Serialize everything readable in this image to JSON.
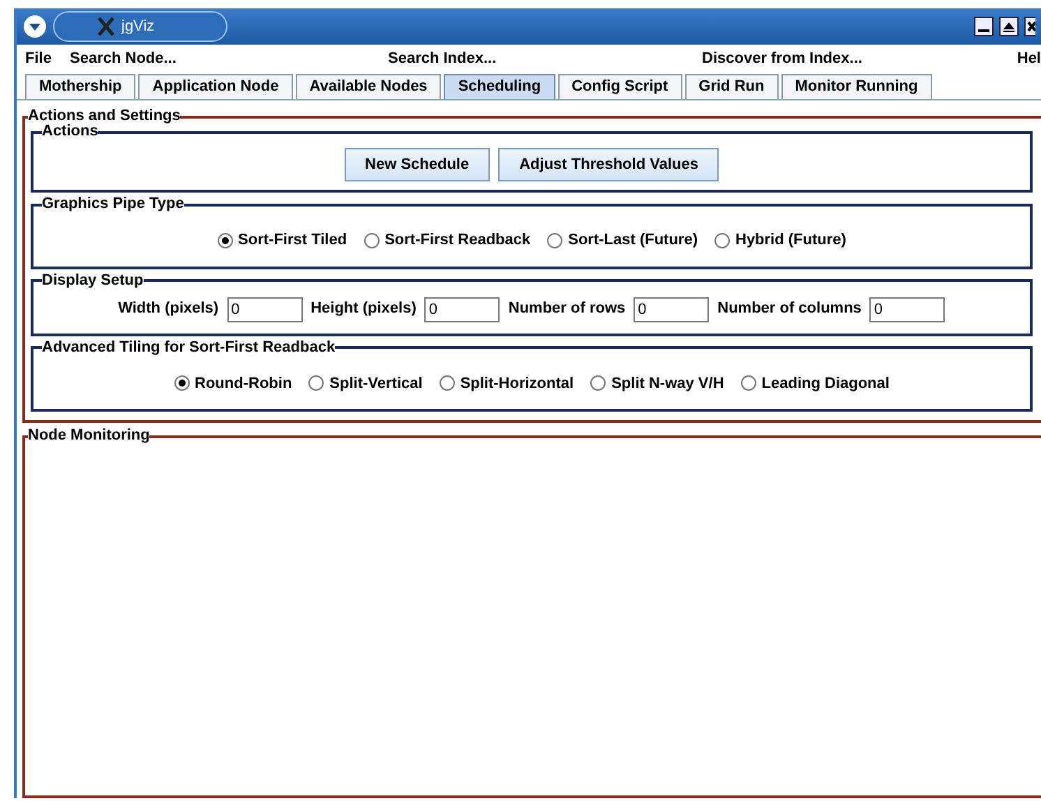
{
  "window": {
    "title": "jgViz"
  },
  "menu": [
    "File",
    "Search Node...",
    "Search Index...",
    "Discover from Index...",
    "Hel"
  ],
  "tabs": [
    {
      "label": "Mothership",
      "selected": false
    },
    {
      "label": "Application Node",
      "selected": false
    },
    {
      "label": "Available Nodes",
      "selected": false
    },
    {
      "label": "Scheduling",
      "selected": true
    },
    {
      "label": "Config Script",
      "selected": false
    },
    {
      "label": "Grid Run",
      "selected": false
    },
    {
      "label": "Monitor Running",
      "selected": false
    }
  ],
  "panels": [
    {
      "title": "Actions and Settings",
      "sections": [
        {
          "title": "Actions",
          "kind": "buttons",
          "buttons": [
            "New Schedule",
            "Adjust Threshold Values"
          ]
        },
        {
          "title": "Graphics Pipe Type",
          "kind": "radios",
          "options": [
            {
              "label": "Sort-First Tiled",
              "selected": true
            },
            {
              "label": "Sort-First Readback",
              "selected": false
            },
            {
              "label": "Sort-Last (Future)",
              "selected": false
            },
            {
              "label": "Hybrid (Future)",
              "selected": false
            }
          ]
        },
        {
          "title": "Display Setup",
          "kind": "fields",
          "fields": [
            {
              "label": "Width (pixels)",
              "value": "0"
            },
            {
              "label": "Height (pixels)",
              "value": "0"
            },
            {
              "label": "Number of rows",
              "value": "0"
            },
            {
              "label": "Number of columns",
              "value": "0"
            }
          ]
        },
        {
          "title": "Advanced Tiling for Sort-First Readback",
          "kind": "radios",
          "options": [
            {
              "label": "Round-Robin",
              "selected": true
            },
            {
              "label": "Split-Vertical",
              "selected": false
            },
            {
              "label": "Split-Horizontal",
              "selected": false
            },
            {
              "label": "Split N-way V/H",
              "selected": false
            },
            {
              "label": "Leading Diagonal",
              "selected": false
            }
          ]
        }
      ]
    },
    {
      "title": "Node Monitoring"
    }
  ]
}
